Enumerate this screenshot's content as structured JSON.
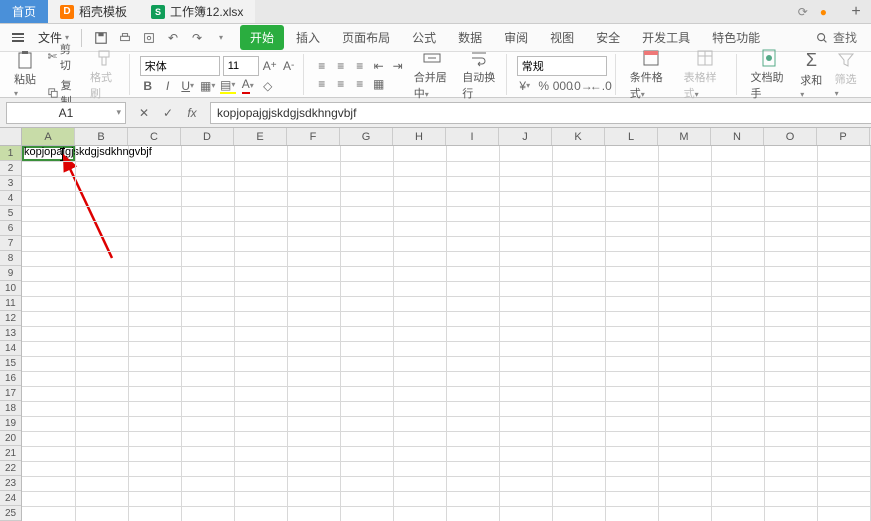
{
  "tabs": {
    "home": "首页",
    "docer": "稻壳模板",
    "workbook": "工作簿12.xlsx"
  },
  "menu": {
    "file": "文件",
    "ribbon": {
      "start": "开始",
      "insert": "插入",
      "layout": "页面布局",
      "formula": "公式",
      "data": "数据",
      "review": "审阅",
      "view": "视图",
      "security": "安全",
      "dev": "开发工具",
      "special": "特色功能"
    },
    "search": "查找"
  },
  "ribbon": {
    "paste": "粘贴",
    "cut": "剪切",
    "copy": "复制",
    "format_painter": "格式刷",
    "font_name": "宋体",
    "font_size": "11",
    "merge_center": "合并居中",
    "auto_wrap": "自动换行",
    "number_format": "常规",
    "cond_format": "条件格式",
    "table_style": "表格样式",
    "doc_assist": "文档助手",
    "sum": "求和",
    "filter": "筛选"
  },
  "formula_bar": {
    "name_box": "A1",
    "formula": "kopjopajgjskdgjsdkhngvbjf"
  },
  "grid": {
    "columns": [
      "A",
      "B",
      "C",
      "D",
      "E",
      "F",
      "G",
      "H",
      "I",
      "J",
      "K",
      "L",
      "M",
      "N",
      "O",
      "P"
    ],
    "rows": [
      "1",
      "2",
      "3",
      "4",
      "5",
      "6",
      "7",
      "8",
      "9",
      "10",
      "11",
      "12",
      "13",
      "14",
      "15",
      "16",
      "17",
      "18",
      "19",
      "20",
      "21",
      "22",
      "23",
      "24",
      "25"
    ],
    "active_col": "A",
    "active_row": "1",
    "cell_value": "kopjopajgjskdgjsdkhngvbjf"
  }
}
